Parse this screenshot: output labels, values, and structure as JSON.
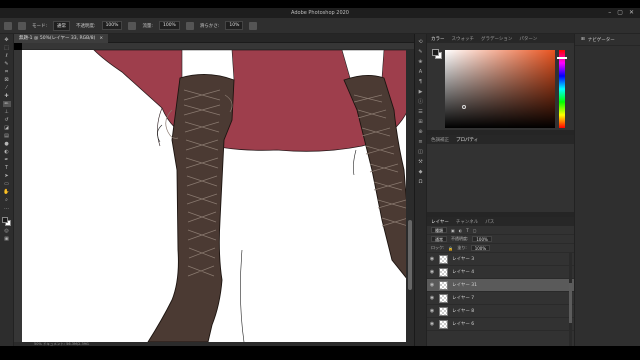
{
  "app": {
    "title": "Adobe Photoshop 2020"
  },
  "options": {
    "mode_label": "モード:",
    "mode_value": "通常",
    "opacity_label": "不透明度:",
    "opacity_value": "100%",
    "flow_label": "流量:",
    "flow_value": "100%",
    "smoothing_label": "滑らかさ:",
    "smoothing_value": "10%"
  },
  "document": {
    "tab_title": "無題-1 @ 50%(レイヤー 33, RGB/8)",
    "zoom": "50%",
    "status": "50%  ドキュメント: 56.3M/2.39G"
  },
  "color_panel": {
    "tabs": [
      "カラー",
      "スウォッチ",
      "グラデーション",
      "パターン"
    ]
  },
  "mid_panel": {
    "tabs": [
      "色調補正",
      "プロパティ"
    ]
  },
  "layers_panel": {
    "tabs": [
      "レイヤー",
      "チャンネル",
      "パス"
    ],
    "kind": "種類",
    "blend": "通常",
    "opacity_label": "不透明度:",
    "opacity_value": "100%",
    "lock_label": "ロック:",
    "fill_label": "塗り:",
    "fill_value": "100%",
    "layers": [
      {
        "name": "レイヤー 3",
        "selected": false
      },
      {
        "name": "レイヤー 4",
        "selected": false
      },
      {
        "name": "レイヤー 31",
        "selected": true
      },
      {
        "name": "レイヤー 7",
        "selected": false
      },
      {
        "name": "レイヤー 8",
        "selected": false
      },
      {
        "name": "レイヤー 6",
        "selected": false
      }
    ]
  },
  "far_panel": {
    "title": "ナビゲーター"
  },
  "colors": {
    "skirt": "#9e3e4c",
    "boot": "#4b3a33",
    "lace": "#8a7a70"
  }
}
